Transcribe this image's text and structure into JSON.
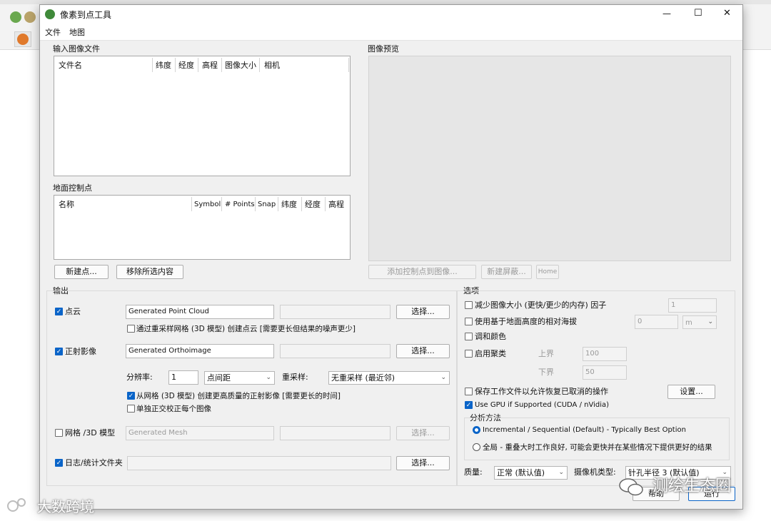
{
  "dialog": {
    "title": "像素到点工具",
    "menu": [
      "文件",
      "地图"
    ],
    "controls": {
      "minimize": "—",
      "maximize": "☐",
      "close": "✕"
    }
  },
  "input_images": {
    "title": "输入图像文件",
    "columns": [
      "文件名",
      "纬度",
      "经度",
      "高程",
      "图像大小",
      "相机"
    ]
  },
  "gcp": {
    "title": "地面控制点",
    "columns": [
      "名称",
      "Symbol",
      "# Points",
      "Snap",
      "纬度",
      "经度",
      "高程"
    ],
    "new_point_btn": "新建点...",
    "remove_btn": "移除所选内容"
  },
  "preview": {
    "title": "图像预览",
    "add_gcp_btn": "添加控制点到图像...",
    "new_mask_btn": "新建屏蔽...",
    "home_btn": "Home"
  },
  "output": {
    "title": "输出",
    "point_cloud": {
      "label": "点云",
      "checked": true,
      "name": "Generated Point Cloud",
      "choose": "选择..."
    },
    "point_cloud_option": {
      "label": "通过重采样网格 (3D 模型) 创建点云 [需要更长但结果的噪声更少]",
      "checked": false
    },
    "ortho": {
      "label": "正射影像",
      "checked": true,
      "name": "Generated Orthoimage",
      "choose": "选择..."
    },
    "resolution_label": "分辨率:",
    "resolution_value": "1",
    "resolution_unit": "点间距",
    "resample_label": "重采样:",
    "resample_value": "无重采样 (最近邻)",
    "ortho_opt1": {
      "label": "从网格 (3D 模型) 创建更高质量的正射影像 [需要更长的时间]",
      "checked": true
    },
    "ortho_opt2": {
      "label": "单独正交校正每个图像",
      "checked": false
    },
    "mesh": {
      "label": "网格 /3D 模型",
      "checked": false,
      "name": "Generated Mesh",
      "choose": "选择..."
    },
    "log": {
      "label": "日志/统计文件夹",
      "checked": true,
      "choose": "选择..."
    }
  },
  "options": {
    "title": "选项",
    "reduce_size": {
      "label": "减少图像大小 (更快/更少的内存) 因子",
      "checked": false,
      "value": "1"
    },
    "relative_alt": {
      "label": "使用基于地面高度的相对海拔",
      "checked": false,
      "value": "0",
      "unit": "m"
    },
    "adjust_color": {
      "label": "调和颜色",
      "checked": false
    },
    "clustering": {
      "label": "启用聚类",
      "checked": false,
      "upper_label": "上界",
      "upper_value": "100",
      "lower_label": "下界",
      "lower_value": "50"
    },
    "save_work": {
      "label": "保存工作文件以允许恢复已取消的操作",
      "checked": false
    },
    "settings_btn": "设置...",
    "gpu": {
      "label": "Use GPU if Supported (CUDA / nVidia)",
      "checked": true
    },
    "analysis": {
      "title": "分析方法",
      "opt1": "Incremental / Sequential (Default) - Typically Best Option",
      "opt2": "全局 - 重叠大时工作良好, 可能会更快并在某些情况下提供更好的结果",
      "selected": 1
    },
    "quality_label": "质量:",
    "quality_value": "正常 (默认值)",
    "camera_label": "摄像机类型:",
    "camera_value": "针孔半径 3 (默认值)"
  },
  "footer": {
    "help_btn": "帮助",
    "run_btn": "运行"
  },
  "watermarks": {
    "left": "大数跨境",
    "right": "测绘生态圈"
  },
  "colors": {
    "accent": "#0a64c8",
    "panel": "#f0f0f0"
  }
}
